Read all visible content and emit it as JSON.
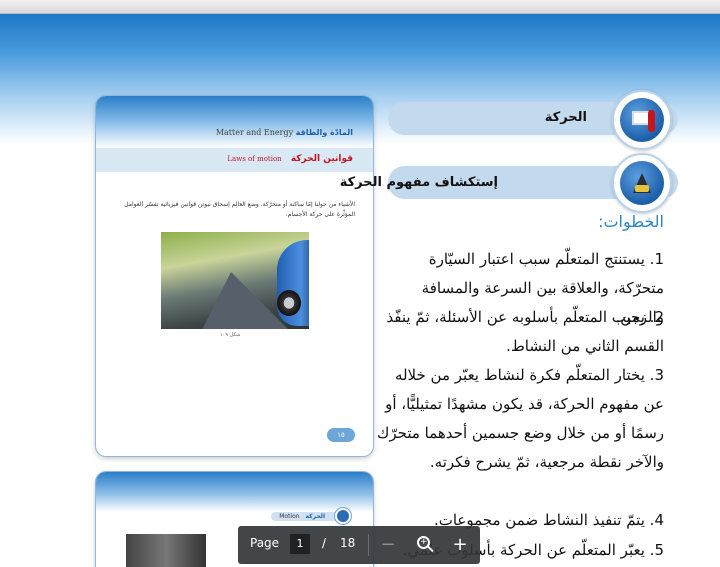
{
  "thumb1": {
    "subject_ar": "المادّة والطاقة",
    "subject_en": "Matter and Energy",
    "lesson_ar": "قوانين الحركة",
    "lesson_en": "Laws of motion",
    "body_text": "الأشياء من حولنا إمّا ساكنة أو متحرّكة. وضع العالِم إسحاق نيوتن قوانين فيزيائية تفسّر العوامل المؤثِّرة على حركة الأجسام.",
    "caption": "شكل ١٠٩",
    "page_number": "١٥"
  },
  "thumb2": {
    "tag_en": "Motion",
    "tag_ar": "الحركة"
  },
  "section": {
    "heading_motion": "الحركة",
    "heading_explore": "إستكشاف مفهوم الحركة",
    "steps_title": "الخطوات:",
    "steps": [
      {
        "num": "1.",
        "text": "يستنتج المتعلّم سبب اعتبار السيّارة متحرّكة، والعلاقة بين السرعة والمسافة والزمن."
      },
      {
        "num": "2.",
        "text": "يجيب المتعلّم بأسلوبه عن الأسئلة، ثمّ ينفّذ القسم الثاني من النشاط."
      },
      {
        "num": "3.",
        "text": "يختار المتعلّم فكرة لنشاط يعبّر من خلاله عن مفهوم الحركة، قد يكون مشهدًا تمثيليًّا، أو رسمًا أو من خلال وضع جسمين أحدهما متحرّك والآخر نقطة مرجعية، ثمّ يشرح فكرته."
      },
      {
        "num": "4.",
        "text": "يتمّ تنفيذ النشاط ضمن مجموعات."
      },
      {
        "num": "5.",
        "text": "يعبّر المتعلّم عن الحركة بأسلوب علمي."
      }
    ]
  },
  "pdf_toolbar": {
    "page_label": "Page",
    "current_page": "1",
    "separator": "/",
    "total_pages": "18",
    "zoom_out": "−",
    "zoom_in": "+"
  }
}
